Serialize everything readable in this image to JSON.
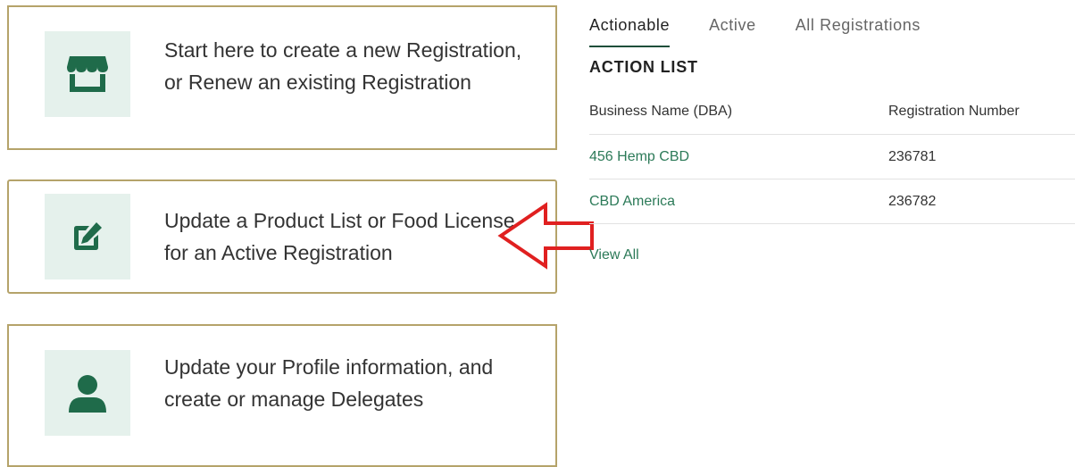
{
  "cards": [
    {
      "text": "Start here to create a new Registration, or Renew an existing Registration",
      "icon": "store-icon"
    },
    {
      "text": "Update a Product List or Food License for an Active Registration",
      "icon": "edit-icon"
    },
    {
      "text": "Update your Profile information, and create or manage Delegates",
      "icon": "user-icon"
    }
  ],
  "tabs": [
    {
      "label": "Actionable",
      "active": true
    },
    {
      "label": "Active",
      "active": false
    },
    {
      "label": "All Registrations",
      "active": false
    }
  ],
  "action_list": {
    "title": "ACTION LIST",
    "columns": [
      "Business Name (DBA)",
      "Registration Number"
    ],
    "rows": [
      {
        "name": "456 Hemp CBD",
        "number": "236781"
      },
      {
        "name": "CBD America",
        "number": "236782"
      }
    ],
    "view_all": "View All"
  },
  "colors": {
    "accent": "#2c7a58",
    "card_border": "#b5a36a",
    "icon_bg": "#e5f1ec",
    "annotation_arrow": "#e02020"
  }
}
